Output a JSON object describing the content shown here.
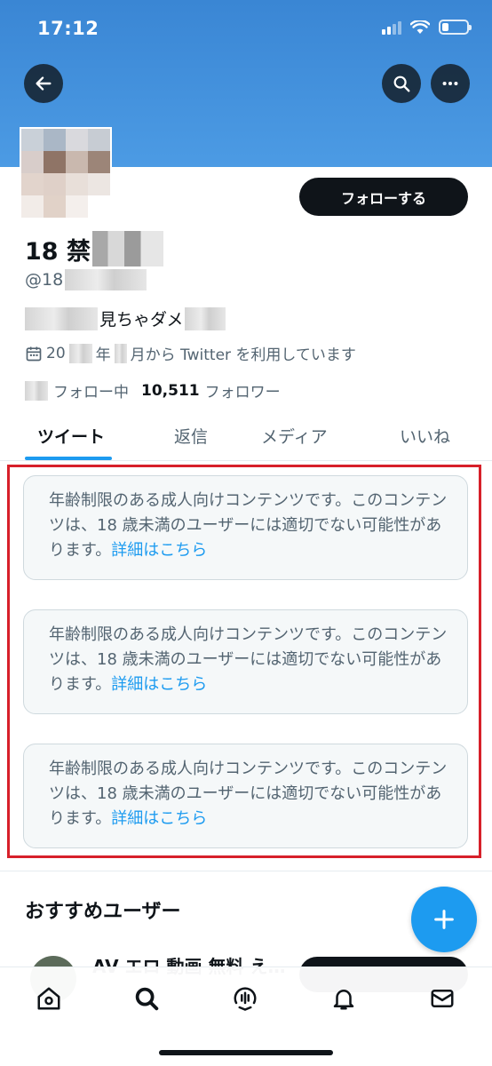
{
  "status_bar": {
    "time": "17:12"
  },
  "profile": {
    "follow_label": "フォローする",
    "name_visible": "18 禁",
    "handle_visible": "@18",
    "bio_visible": "見ちゃダメ",
    "joined_prefix": "20",
    "joined_year": "年",
    "joined_suffix": "月から Twitter を利用しています",
    "following_label": "フォロー中",
    "followers_count": "10,511",
    "followers_label": "フォロワー"
  },
  "tabs": [
    {
      "label": "ツイート"
    },
    {
      "label": "返信"
    },
    {
      "label": "メディア"
    },
    {
      "label": "いいね"
    }
  ],
  "notices": [
    {
      "text": "年齢制限のある成人向けコンテンツです。このコンテンツは、18 歳未満のユーザーには適切でない可能性があります。",
      "link": "詳細はこちら"
    },
    {
      "text": "年齢制限のある成人向けコンテンツです。このコンテンツは、18 歳未満のユーザーには適切でない可能性があります。",
      "link": "詳細はこちら"
    },
    {
      "text": "年齢制限のある成人向けコンテンツです。このコンテンツは、18 歳未満のユーザーには適切でない可能性があります。",
      "link": "詳細はこちら"
    }
  ],
  "recommendations": {
    "title": "おすすめユーザー",
    "first_user_name": "AV エロ 動画 無料 え…"
  },
  "icons": {
    "back": "arrow-left-icon",
    "search": "search-icon",
    "more": "more-horizontal-icon",
    "calendar": "calendar-icon",
    "compose": "plus-icon",
    "tabbar": [
      "home-icon",
      "search-icon",
      "spaces-icon",
      "bell-icon",
      "mail-icon"
    ]
  },
  "colors": {
    "banner": "#4c9be4",
    "accent": "#1d9bf0",
    "highlight_border": "#d7202a"
  }
}
